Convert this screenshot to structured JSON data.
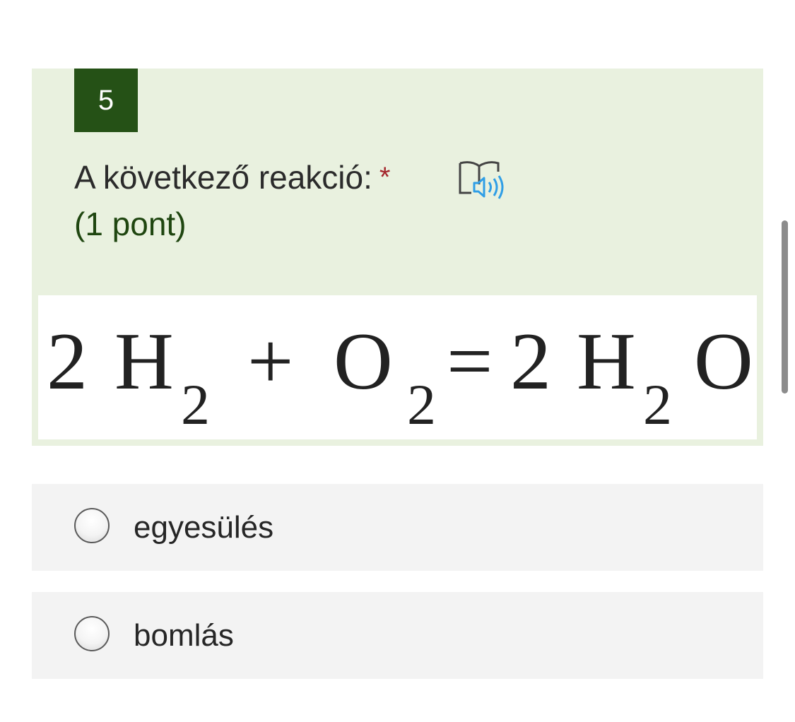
{
  "question": {
    "number": "5",
    "title": "A következő reakció:",
    "required_marker": "*",
    "points": "(1 pont)",
    "immersive_reader_icon": "immersive-reader-icon",
    "equation": {
      "coef1": "2",
      "h1": "H",
      "sub1": "2",
      "plus": "+",
      "o": "O",
      "sub2": "2",
      "equals": "=",
      "coef2": "2",
      "h2": "H",
      "sub3": "2",
      "o2": "O"
    }
  },
  "options": [
    {
      "label": "egyesülés",
      "selected": false
    },
    {
      "label": "bomlás",
      "selected": false
    }
  ],
  "colors": {
    "card_background": "#e9f1df",
    "number_badge": "#255116",
    "points_text": "#1f4610",
    "required_star": "#a4262c",
    "option_background": "#f3f3f3",
    "reader_icon_accent": "#2f9ee6"
  }
}
